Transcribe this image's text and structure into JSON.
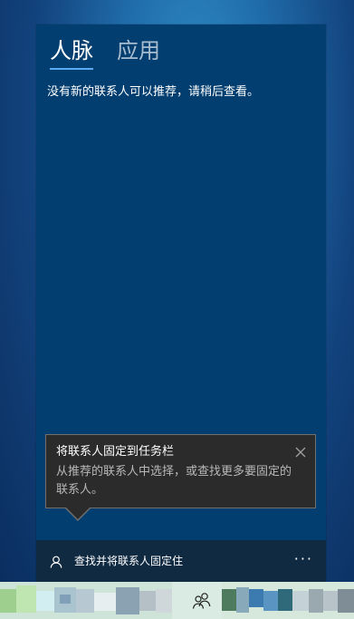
{
  "tabs": [
    {
      "label": "人脉",
      "active": true
    },
    {
      "label": "应用",
      "active": false
    }
  ],
  "message": "没有新的联系人可以推荐，请稍后查看。",
  "tooltip": {
    "title": "将联系人固定到任务栏",
    "body": "从推荐的联系人中选择，或查找更多要固定的联系人。",
    "close_icon": "close-icon"
  },
  "footer": {
    "person_icon": "person-icon",
    "label": "查找并将联系人固定住",
    "more_label": "···"
  },
  "taskbar": {
    "people_icon": "people-icon"
  },
  "colors": {
    "panel_bg": "#023e6f",
    "footer_bg": "#102a42",
    "tooltip_bg": "#2b2b2b",
    "active_tab_underline": "#5ba9f0"
  }
}
